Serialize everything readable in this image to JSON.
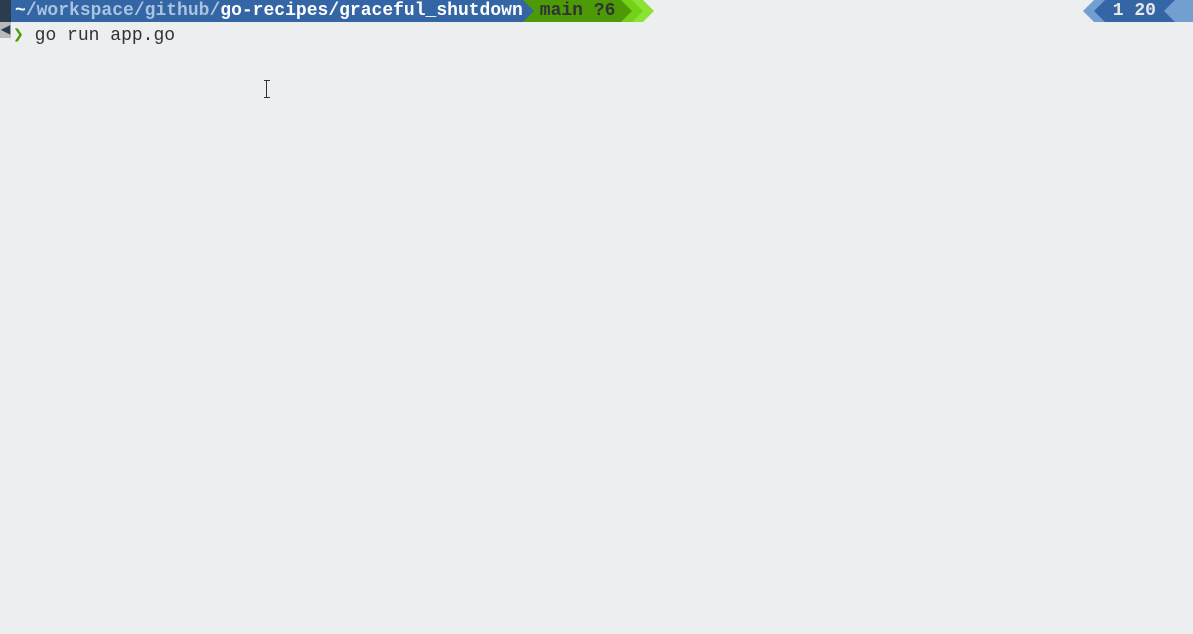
{
  "statusbar": {
    "path": {
      "tilde": "~",
      "sep1": "/",
      "dir1": "workspace",
      "sep2": "/",
      "dir2": "github",
      "sep3": "/",
      "dir3": "go-recipes",
      "sep4": "/",
      "dir4": "graceful_shutdown"
    },
    "branch": "main ?6",
    "right": "1 20"
  },
  "prompt": {
    "symbol": "❯",
    "command": "go run app.go"
  },
  "left_edge": {
    "arrow": "◀"
  }
}
